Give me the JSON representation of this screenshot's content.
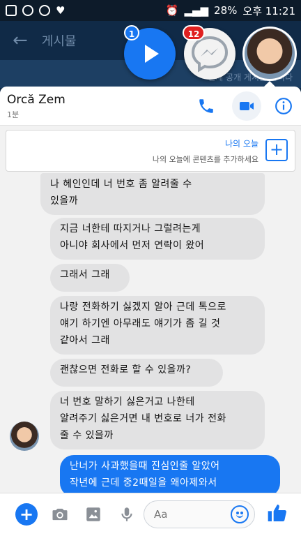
{
  "status_bar": {
    "battery": "28%",
    "time": "오후 11:21"
  },
  "underlay": {
    "back_label": "게시물",
    "strip_text": "전체 공개 게시물 입니다"
  },
  "chat_heads": {
    "first_badge": "1",
    "second_badge": "12"
  },
  "conversation": {
    "name": "Orcă Zem",
    "subtitle": "1분"
  },
  "story": {
    "title": "나의 오늘",
    "description": "나의 오늘에 콘텐츠를 추가하세요",
    "add_label": "+"
  },
  "messages": [
    {
      "from": "them",
      "text": "나 헤인인데 너 번호 좀 알려줄 수\n있을까"
    },
    {
      "from": "them",
      "text": "지금 너한테 따지거나 그럴려는게\n아니야 회사에서 먼저 연락이 왔어"
    },
    {
      "from": "them",
      "text": "그래서 그래"
    },
    {
      "from": "them",
      "text": "나랑 전화하기 싫겠지 알아 근데 톡으로\n얘기 하기엔 아무래도 얘기가 좀 길 것\n같아서 그래"
    },
    {
      "from": "them",
      "text": "괜찮으면 전화로 할 수 있을까?"
    },
    {
      "from": "them",
      "text": "너 번호 말하기 싫은거고 나한테\n알려주기 싫은거면 내 번호로 너가 전화\n줄 수 있을까"
    },
    {
      "from": "me",
      "text": "난너가 사과했을때 진심인줄 알았어\n작년에 근데 중2때일을 왜아제와서"
    }
  ],
  "composer": {
    "placeholder": "Aa",
    "plus_label": "+"
  },
  "icons": {
    "accent_color": "#1877f2"
  }
}
